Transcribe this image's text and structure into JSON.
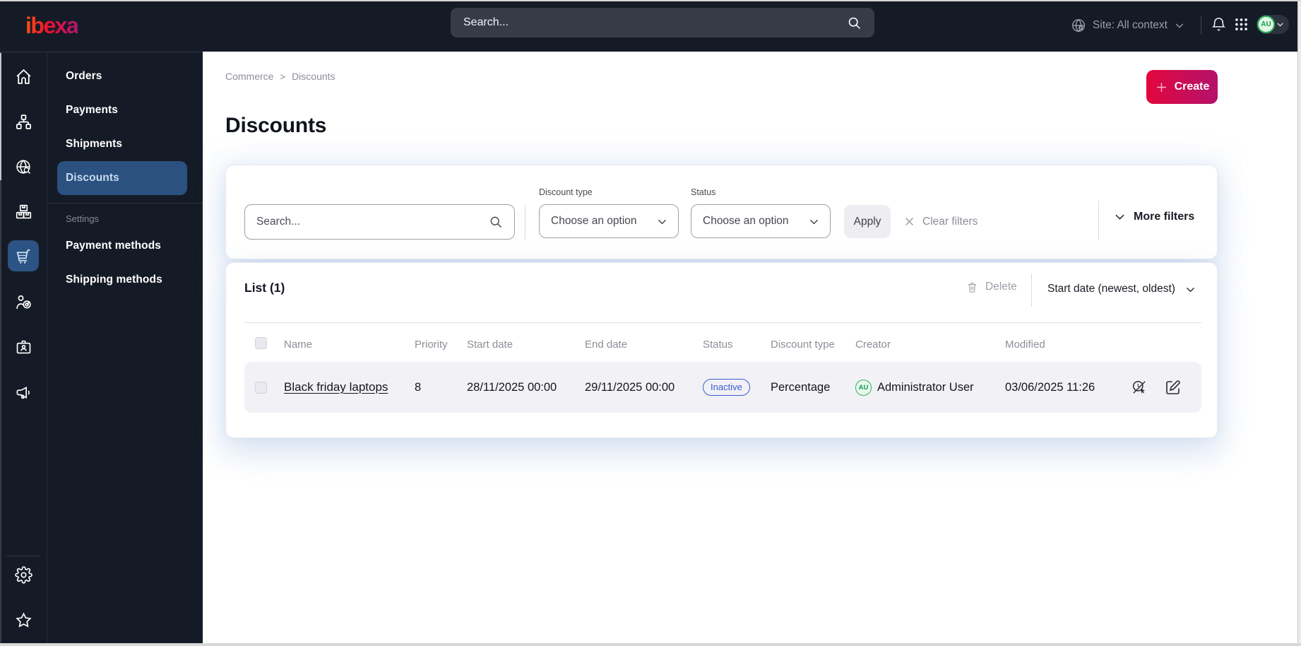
{
  "topbar": {
    "logo_text": "ibexa",
    "search_placeholder": "Search...",
    "site_label": "Site: All context",
    "avatar_initials": "AU",
    "icons": [
      "globe-icon",
      "chevron-down-icon",
      "bell-icon",
      "app-grid-icon",
      "avatar-chevron-icon"
    ]
  },
  "icon_rail": {
    "items": [
      "home",
      "content-tree",
      "search-globe",
      "product-catalog",
      "commerce-cart",
      "customers",
      "corporate",
      "marketing"
    ],
    "bottom_items": [
      "settings-gear",
      "bookmarks-star"
    ],
    "active_item": "commerce-cart",
    "active_color": "#2b5383"
  },
  "sidebar": {
    "items": [
      {
        "label": "Orders"
      },
      {
        "label": "Payments"
      },
      {
        "label": "Shipments"
      },
      {
        "label": "Discounts"
      }
    ],
    "active_item": "Discounts",
    "section_label": "Settings",
    "section_items": [
      {
        "label": "Payment methods"
      },
      {
        "label": "Shipping methods"
      }
    ],
    "active_color": "#2b5181"
  },
  "breadcrumb": {
    "items": [
      "Commerce",
      "Discounts"
    ],
    "separator": ">"
  },
  "page": {
    "title": "Discounts",
    "create_button": "Create"
  },
  "filters": {
    "search_placeholder": "Search...",
    "discount_type_label": "Discount type",
    "discount_type_value": "Choose an option",
    "status_label": "Status",
    "status_value": "Choose an option",
    "apply_button": "Apply",
    "clear_button": "Clear filters",
    "more_filters": "More filters"
  },
  "list": {
    "title": "List (1)",
    "delete_button": "Delete",
    "sort_selector": "Start date (newest, oldest)",
    "columns": [
      "Name",
      "Priority",
      "Start date",
      "End date",
      "Status",
      "Discount type",
      "Creator",
      "Modified"
    ],
    "rows": [
      {
        "name": "Black friday laptops",
        "priority": "8",
        "start_date": "28/11/2025 00:00",
        "end_date": "29/11/2025 00:00",
        "status": "Inactive",
        "discount_type": "Percentage",
        "creator": "Administrator User",
        "creator_initials": "AU",
        "modified": "03/06/2025 11:26",
        "actions": [
          "preview-disabled",
          "edit"
        ]
      }
    ]
  },
  "colors": {
    "topbar_bg": "#151b26",
    "active_blue": "#2b5181",
    "accent_gradient": [
      "#e2063e",
      "#b4136b"
    ],
    "status_inactive": "#3f5ed2",
    "avatar_green": "#2eb45c"
  }
}
